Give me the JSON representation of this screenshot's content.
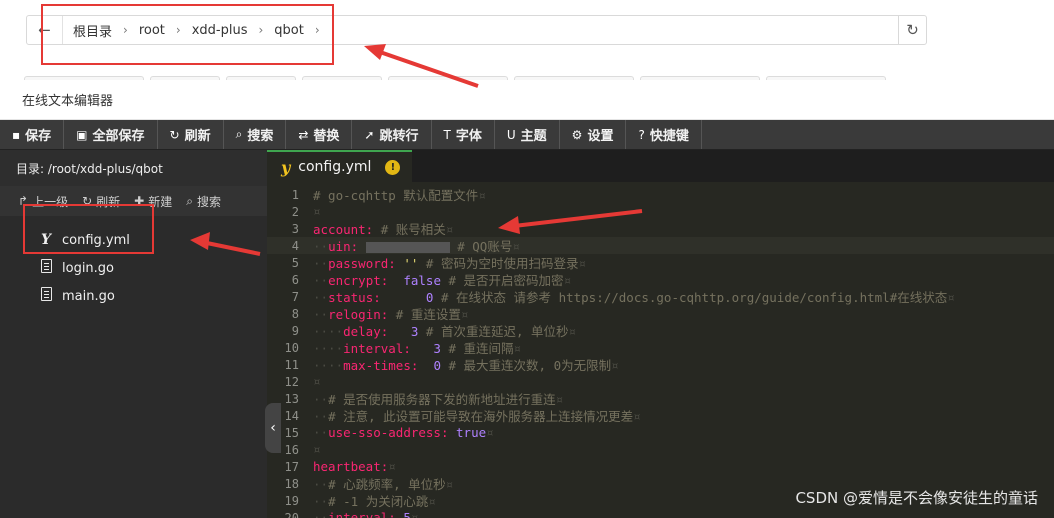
{
  "breadcrumb": {
    "back_icon": "arrow-left-icon",
    "items": [
      "根目录",
      "root",
      "xdd-plus",
      "qbot"
    ],
    "separator": "›",
    "refresh_icon": "refresh-icon"
  },
  "editor": {
    "title": "在线文本编辑器",
    "toolbar": [
      {
        "icon": "save-icon",
        "glyph": "▪",
        "label": "保存"
      },
      {
        "icon": "save-all-icon",
        "glyph": "▣",
        "label": "全部保存"
      },
      {
        "icon": "refresh-icon",
        "glyph": "↻",
        "label": "刷新"
      },
      {
        "icon": "search-icon",
        "glyph": "⌕",
        "label": "搜索"
      },
      {
        "icon": "replace-icon",
        "glyph": "⇄",
        "label": "替换"
      },
      {
        "icon": "goto-line-icon",
        "glyph": "➚",
        "label": "跳转行"
      },
      {
        "icon": "font-icon",
        "glyph": "T",
        "label": "字体"
      },
      {
        "icon": "theme-icon",
        "glyph": "U",
        "label": "主题"
      },
      {
        "icon": "gear-icon",
        "glyph": "⚙",
        "label": "设置"
      },
      {
        "icon": "help-icon",
        "glyph": "?",
        "label": "快捷键"
      }
    ],
    "sidebar": {
      "dir_label": "目录: /root/xdd-plus/qbot",
      "actions": [
        {
          "icon": "up-level-icon",
          "glyph": "↱",
          "label": "上一级"
        },
        {
          "icon": "refresh-icon",
          "glyph": "↻",
          "label": "刷新"
        },
        {
          "icon": "plus-icon",
          "glyph": "✚",
          "label": "新建"
        },
        {
          "icon": "search-icon",
          "glyph": "⌕",
          "label": "搜索"
        }
      ],
      "files": [
        {
          "name": "config.yml",
          "icon": "yaml-file-icon"
        },
        {
          "name": "login.go",
          "icon": "document-icon"
        },
        {
          "name": "main.go",
          "icon": "document-icon"
        }
      ]
    },
    "tab": {
      "name": "config.yml",
      "icon": "yaml-file-icon",
      "status_icon": "warning-icon"
    },
    "code_lines": [
      {
        "n": 1,
        "text": "# go-cqhttp 默认配置文件¤"
      },
      {
        "n": 2,
        "text": "¤"
      },
      {
        "n": 3,
        "text": "account: # 账号相关¤"
      },
      {
        "n": 4,
        "text": "  uin:          # QQ账号¤"
      },
      {
        "n": 5,
        "text": "  password: '' # 密码为空时使用扫码登录¤"
      },
      {
        "n": 6,
        "text": "  encrypt: false  # 是否开启密码加密¤"
      },
      {
        "n": 7,
        "text": "  status: 0      # 在线状态 请参考 https://docs.go-cqhttp.org/guide/config.html#在线状态¤"
      },
      {
        "n": 8,
        "text": "  relogin: # 重连设置¤"
      },
      {
        "n": 9,
        "text": "    delay: 3   # 首次重连延迟, 单位秒¤"
      },
      {
        "n": 10,
        "text": "    interval: 3   # 重连间隔¤"
      },
      {
        "n": 11,
        "text": "    max-times: 0  # 最大重连次数, 0为无限制¤"
      },
      {
        "n": 12,
        "text": "¤"
      },
      {
        "n": 13,
        "text": "  # 是否使用服务器下发的新地址进行重连¤"
      },
      {
        "n": 14,
        "text": "  # 注意, 此设置可能导致在海外服务器上连接情况更差¤"
      },
      {
        "n": 15,
        "text": "  use-sso-address: true¤"
      },
      {
        "n": 16,
        "text": "¤"
      },
      {
        "n": 17,
        "text": "heartbeat:¤"
      },
      {
        "n": 18,
        "text": "  # 心跳频率, 单位秒¤"
      },
      {
        "n": 19,
        "text": "  # -1 为关闭心跳¤"
      },
      {
        "n": 20,
        "text": "  interval: 5¤"
      }
    ]
  },
  "watermark": "CSDN @爱情是不会像安徒生的童话",
  "colors": {
    "toolbar": "#3a3a3a",
    "sidebar": "#2b2b2b",
    "editor_bg": "#272822",
    "tab_accent": "#3fa64f",
    "annotation": "#e53935"
  }
}
